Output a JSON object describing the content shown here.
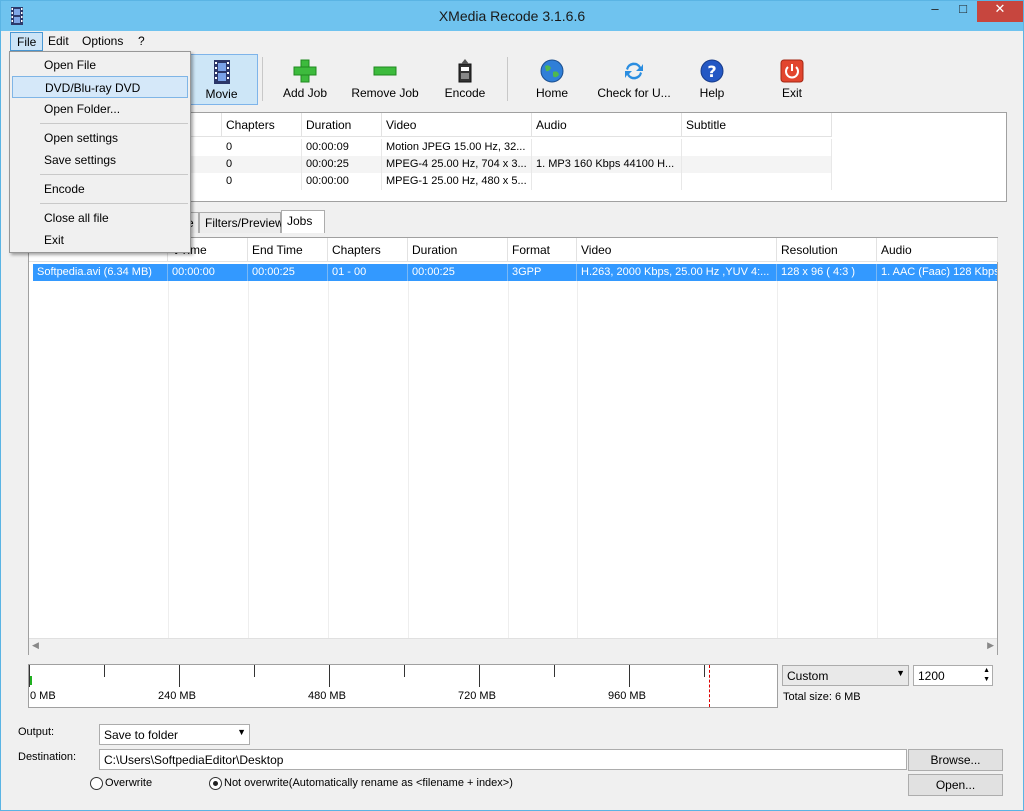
{
  "window": {
    "title": "XMedia Recode 3.1.6.6",
    "controls": {
      "minimize": "–",
      "maximize": "□",
      "close": "✕"
    }
  },
  "menubar": {
    "items": [
      "File",
      "Edit",
      "Options",
      "?"
    ]
  },
  "file_menu": {
    "items": [
      {
        "label": "Open File"
      },
      {
        "label": "DVD/Blu-ray DVD"
      },
      {
        "label": "Open Folder..."
      },
      {
        "label": "Open settings"
      },
      {
        "label": "Save settings"
      },
      {
        "label": "Encode"
      },
      {
        "label": "Close all file"
      },
      {
        "label": "Exit"
      }
    ]
  },
  "toolbar": {
    "movie": "Movie",
    "add_job": "Add Job",
    "remove_job": "Remove Job",
    "encode": "Encode",
    "home": "Home",
    "check_updates": "Check for U...",
    "help": "Help",
    "exit": "Exit"
  },
  "source_table": {
    "headers": [
      "Chapters",
      "Duration",
      "Video",
      "Audio",
      "Subtitle"
    ],
    "rows": [
      [
        "0",
        "00:00:09",
        "Motion JPEG 15.00 Hz, 32...",
        "",
        ""
      ],
      [
        "0",
        "00:00:25",
        "MPEG-4 25.00 Hz, 704 x 3...",
        "1. MP3 160 Kbps 44100 H...",
        ""
      ],
      [
        "0",
        "00:00:00",
        "MPEG-1 25.00 Hz, 480 x 5...",
        "",
        ""
      ]
    ]
  },
  "tabs": {
    "partial": "e",
    "filters": "Filters/Preview",
    "jobs": "Jobs"
  },
  "jobs_table": {
    "headers": [
      "t Time",
      "End Time",
      "Chapters",
      "Duration",
      "Format",
      "Video",
      "Resolution",
      "Audio"
    ],
    "rows": [
      [
        "Softpedia.avi (6.34 MB)",
        "00:00:00",
        "00:00:25",
        "01 - 00",
        "00:00:25",
        "3GPP",
        "H.263, 2000 Kbps, 25.00 Hz ,YUV 4:...",
        "128 x 96 ( 4:3 )",
        "1. AAC (Faac) 128 Kbps"
      ]
    ]
  },
  "size_scale": {
    "labels": [
      "0 MB",
      "240 MB",
      "480 MB",
      "720 MB",
      "960 MB"
    ],
    "preset": "Custom",
    "size_value": "1200",
    "total_size": "Total size: 6 MB"
  },
  "output": {
    "output_label": "Output:",
    "output_value": "Save to folder",
    "destination_label": "Destination:",
    "destination_value": "C:\\Users\\SoftpediaEditor\\Desktop",
    "browse": "Browse...",
    "open": "Open...",
    "overwrite": "Overwrite",
    "not_overwrite": "Not overwrite(Automatically rename as <filename + index>)"
  },
  "colors": {
    "titlebar": "#6fc3ef",
    "selection": "#3399ff",
    "close": "#c7463e"
  }
}
